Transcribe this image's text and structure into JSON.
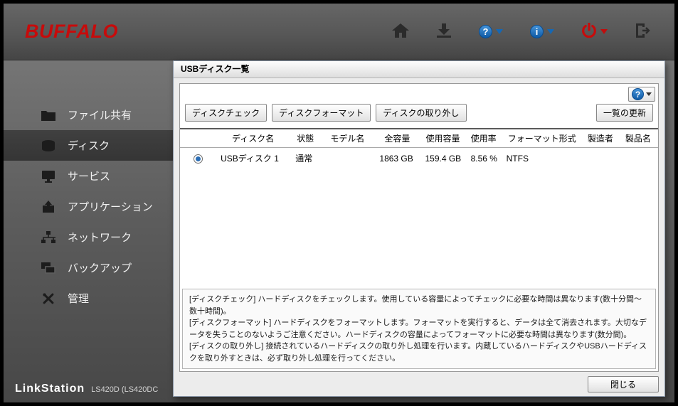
{
  "colors": {
    "accent_blue": "#1668b4",
    "accent_red": "#c70b0b"
  },
  "glyphs": {
    "help": "?",
    "info": "i"
  },
  "header": {
    "logo_text": "BUFFALO",
    "icons": [
      {
        "name": "home-icon",
        "color": "#2b2b2b",
        "dropdown": false
      },
      {
        "name": "download-icon",
        "color": "#2b2b2b",
        "dropdown": false
      },
      {
        "name": "help-icon",
        "color": "#1668b4",
        "dropdown": true
      },
      {
        "name": "info-icon",
        "color": "#1668b4",
        "dropdown": true
      },
      {
        "name": "power-icon",
        "color": "#c70b0b",
        "dropdown": true
      },
      {
        "name": "logout-icon",
        "color": "#2b2b2b",
        "dropdown": false
      }
    ]
  },
  "sidebar": {
    "items": [
      {
        "label": "ファイル共有",
        "icon": "folder-icon",
        "selected": false
      },
      {
        "label": "ディスク",
        "icon": "disk-icon",
        "selected": true
      },
      {
        "label": "サービス",
        "icon": "services-icon",
        "selected": false
      },
      {
        "label": "アプリケーション",
        "icon": "applications-icon",
        "selected": false
      },
      {
        "label": "ネットワーク",
        "icon": "network-icon",
        "selected": false
      },
      {
        "label": "バックアップ",
        "icon": "backup-icon",
        "selected": false
      },
      {
        "label": "管理",
        "icon": "tools-icon",
        "selected": false
      }
    ],
    "footer": {
      "brand": "LinkStation",
      "model": "LS420D (LS420DC"
    }
  },
  "dialog": {
    "title": "USBディスク一覧",
    "toolbar": {
      "check_label": "ディスクチェック",
      "format_label": "ディスクフォーマット",
      "remove_label": "ディスクの取り外し",
      "refresh_label": "一覧の更新"
    },
    "table": {
      "headers": [
        "ディスク名",
        "状態",
        "モデル名",
        "全容量",
        "使用容量",
        "使用率",
        "フォーマット形式",
        "製造者",
        "製品名"
      ],
      "rows": [
        {
          "selected": true,
          "disk_name": "USBディスク 1",
          "status": "通常",
          "model": "",
          "total": "1863 GB",
          "used": "159.4 GB",
          "usage": "8.56 %",
          "format": "NTFS",
          "manufacturer": "",
          "product": ""
        }
      ]
    },
    "notes": [
      "[ディスクチェック] ハードディスクをチェックします。使用している容量によってチェックに必要な時間は異なります(数十分間～数十時間)。",
      "[ディスクフォーマット] ハードディスクをフォーマットします。フォーマットを実行すると、データは全て消去されます。大切なデータを失うことのないようご注意ください。ハードディスクの容量によってフォーマットに必要な時間は異なります(数分間)。",
      "[ディスクの取り外し] 接続されているハードディスクの取り外し処理を行います。内蔵しているハードディスクやUSBハードディスクを取り外すときは、必ず取り外し処理を行ってください。"
    ],
    "close_label": "閉じる"
  }
}
